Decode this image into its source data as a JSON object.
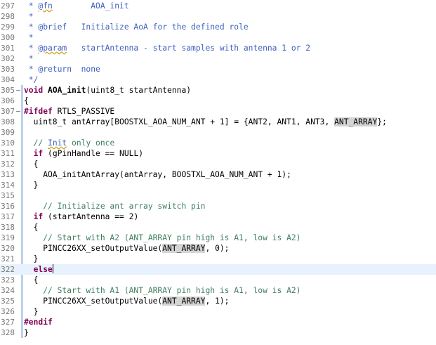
{
  "editor": {
    "lines": [
      {
        "num": "297",
        "tokens": [
          {
            "t": " * ",
            "c": "doc"
          },
          {
            "t": "@fn",
            "c": "link"
          },
          {
            "t": "        AOA_init",
            "c": "doc"
          }
        ]
      },
      {
        "num": "298",
        "tokens": [
          {
            "t": " *",
            "c": "doc"
          }
        ]
      },
      {
        "num": "299",
        "tokens": [
          {
            "t": " * ",
            "c": "doc"
          },
          {
            "t": "@brief",
            "c": "tag"
          },
          {
            "t": "   Initialize AoA for the defined role",
            "c": "doc"
          }
        ]
      },
      {
        "num": "300",
        "tokens": [
          {
            "t": " *",
            "c": "doc"
          }
        ]
      },
      {
        "num": "301",
        "tokens": [
          {
            "t": " * ",
            "c": "doc"
          },
          {
            "t": "@param",
            "c": "link"
          },
          {
            "t": "   startAntenna - start samples with antenna 1 or 2",
            "c": "doc"
          }
        ]
      },
      {
        "num": "302",
        "tokens": [
          {
            "t": " *",
            "c": "doc"
          }
        ]
      },
      {
        "num": "303",
        "tokens": [
          {
            "t": " * ",
            "c": "doc"
          },
          {
            "t": "@return",
            "c": "tag"
          },
          {
            "t": "  none",
            "c": "doc"
          }
        ]
      },
      {
        "num": "304",
        "tokens": [
          {
            "t": " */",
            "c": "doc"
          }
        ]
      },
      {
        "num": "305",
        "fold": "minus",
        "tokens": [
          {
            "t": "void ",
            "c": "kw"
          },
          {
            "t": "AOA_init",
            "c": "fn"
          },
          {
            "t": "(uint8_t startAntenna)",
            "c": "plain"
          }
        ]
      },
      {
        "num": "306",
        "tokens": [
          {
            "t": "{",
            "c": "plain"
          }
        ]
      },
      {
        "num": "307",
        "fold": "minus",
        "tokens": [
          {
            "t": "#ifdef",
            "c": "kw"
          },
          {
            "t": " RTLS_PASSIVE",
            "c": "plain"
          }
        ]
      },
      {
        "num": "308",
        "tokens": [
          {
            "t": "  uint8_t antArray[BOOSTXL_AOA_NUM_ANT + 1] = {ANT2, ANT1, ANT3, ",
            "c": "plain"
          },
          {
            "t": "ANT_ARRAY",
            "c": "hl"
          },
          {
            "t": "};",
            "c": "plain"
          }
        ]
      },
      {
        "num": "309",
        "tokens": [
          {
            "t": "",
            "c": "plain"
          }
        ]
      },
      {
        "num": "310",
        "tokens": [
          {
            "t": "  // ",
            "c": "com"
          },
          {
            "t": "Init",
            "c": "comlink"
          },
          {
            "t": " only once",
            "c": "com"
          }
        ]
      },
      {
        "num": "311",
        "tokens": [
          {
            "t": "  ",
            "c": "plain"
          },
          {
            "t": "if",
            "c": "kw"
          },
          {
            "t": " (gPinHandle == NULL)",
            "c": "plain"
          }
        ]
      },
      {
        "num": "312",
        "tokens": [
          {
            "t": "  {",
            "c": "plain"
          }
        ]
      },
      {
        "num": "313",
        "tokens": [
          {
            "t": "    AOA_initAntArray(antArray, BOOSTXL_AOA_NUM_ANT + 1);",
            "c": "plain"
          }
        ]
      },
      {
        "num": "314",
        "tokens": [
          {
            "t": "  }",
            "c": "plain"
          }
        ]
      },
      {
        "num": "315",
        "tokens": [
          {
            "t": "",
            "c": "plain"
          }
        ]
      },
      {
        "num": "316",
        "tokens": [
          {
            "t": "    // Initialize ant array switch pin",
            "c": "com"
          }
        ]
      },
      {
        "num": "317",
        "tokens": [
          {
            "t": "  ",
            "c": "plain"
          },
          {
            "t": "if",
            "c": "kw"
          },
          {
            "t": " (startAntenna == 2)",
            "c": "plain"
          }
        ]
      },
      {
        "num": "318",
        "tokens": [
          {
            "t": "  {",
            "c": "plain"
          }
        ]
      },
      {
        "num": "319",
        "tokens": [
          {
            "t": "    // Start with A2 (ANT_ARRAY pin high is A1, low is A2)",
            "c": "com"
          }
        ]
      },
      {
        "num": "320",
        "tokens": [
          {
            "t": "    PINCC26XX_setOutputValue(",
            "c": "plain"
          },
          {
            "t": "ANT_ARRAY",
            "c": "hl"
          },
          {
            "t": ", 0);",
            "c": "plain"
          }
        ]
      },
      {
        "num": "321",
        "tokens": [
          {
            "t": "  }",
            "c": "plain"
          }
        ]
      },
      {
        "num": "322",
        "current": true,
        "tokens": [
          {
            "t": "  ",
            "c": "plain"
          },
          {
            "t": "else",
            "c": "kw"
          }
        ]
      },
      {
        "num": "323",
        "tokens": [
          {
            "t": "  {",
            "c": "plain"
          }
        ]
      },
      {
        "num": "324",
        "tokens": [
          {
            "t": "    // Start with A1 (ANT_ARRAY pin high is A1, low is A2)",
            "c": "com"
          }
        ]
      },
      {
        "num": "325",
        "tokens": [
          {
            "t": "    PINCC26XX_setOutputValue(",
            "c": "plain"
          },
          {
            "t": "ANT_ARRAY",
            "c": "hl"
          },
          {
            "t": ", 1);",
            "c": "plain"
          }
        ]
      },
      {
        "num": "326",
        "tokens": [
          {
            "t": "  }",
            "c": "plain"
          }
        ]
      },
      {
        "num": "327",
        "tokens": [
          {
            "t": "#endif",
            "c": "kw"
          }
        ]
      },
      {
        "num": "328",
        "tokens": [
          {
            "t": "}",
            "c": "plain"
          }
        ]
      }
    ]
  }
}
